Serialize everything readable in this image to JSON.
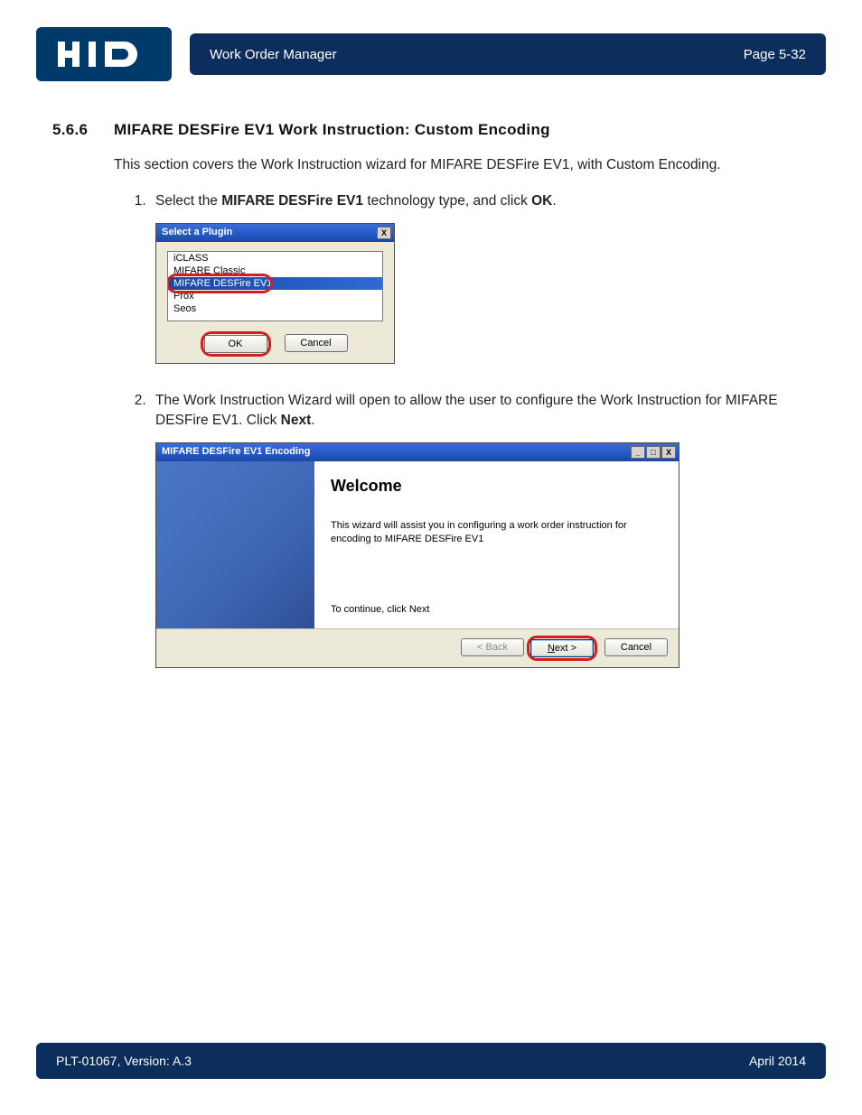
{
  "header": {
    "logo_text": "HID",
    "title": "Work Order Manager",
    "page_label": "Page 5-32"
  },
  "section": {
    "number": "5.6.6",
    "title": "MIFARE DESFire EV1 Work Instruction: Custom Encoding",
    "intro": "This section covers the Work Instruction wizard for MIFARE DESFire EV1, with Custom Encoding."
  },
  "steps": {
    "s1_a": "Select the ",
    "s1_bold": "MIFARE DESFire EV1",
    "s1_b": " technology type, and click ",
    "s1_bold2": "OK",
    "s1_c": ".",
    "s2_a": "The Work Instruction Wizard will open to allow the user to configure the Work Instruction for MIFARE DESFire EV1. Click ",
    "s2_bold": "Next",
    "s2_b": "."
  },
  "plugin_dialog": {
    "title": "Select a Plugin",
    "items": [
      "iCLASS",
      "MIFARE Classic",
      "MIFARE DESFire EV1",
      "Prox",
      "Seos"
    ],
    "ok": "OK",
    "cancel": "Cancel",
    "close_glyph": "X"
  },
  "wizard_dialog": {
    "title": "MIFARE DESFire EV1 Encoding",
    "min_glyph": "_",
    "max_glyph": "□",
    "close_glyph": "X",
    "heading": "Welcome",
    "desc": "This wizard will assist you in configuring a work order instruction for encoding to MIFARE DESFire EV1",
    "continue": "To continue, click Next",
    "back": "< Back",
    "next": "Next >",
    "cancel": "Cancel"
  },
  "footer": {
    "left": "PLT-01067, Version: A.3",
    "right": "April 2014"
  }
}
